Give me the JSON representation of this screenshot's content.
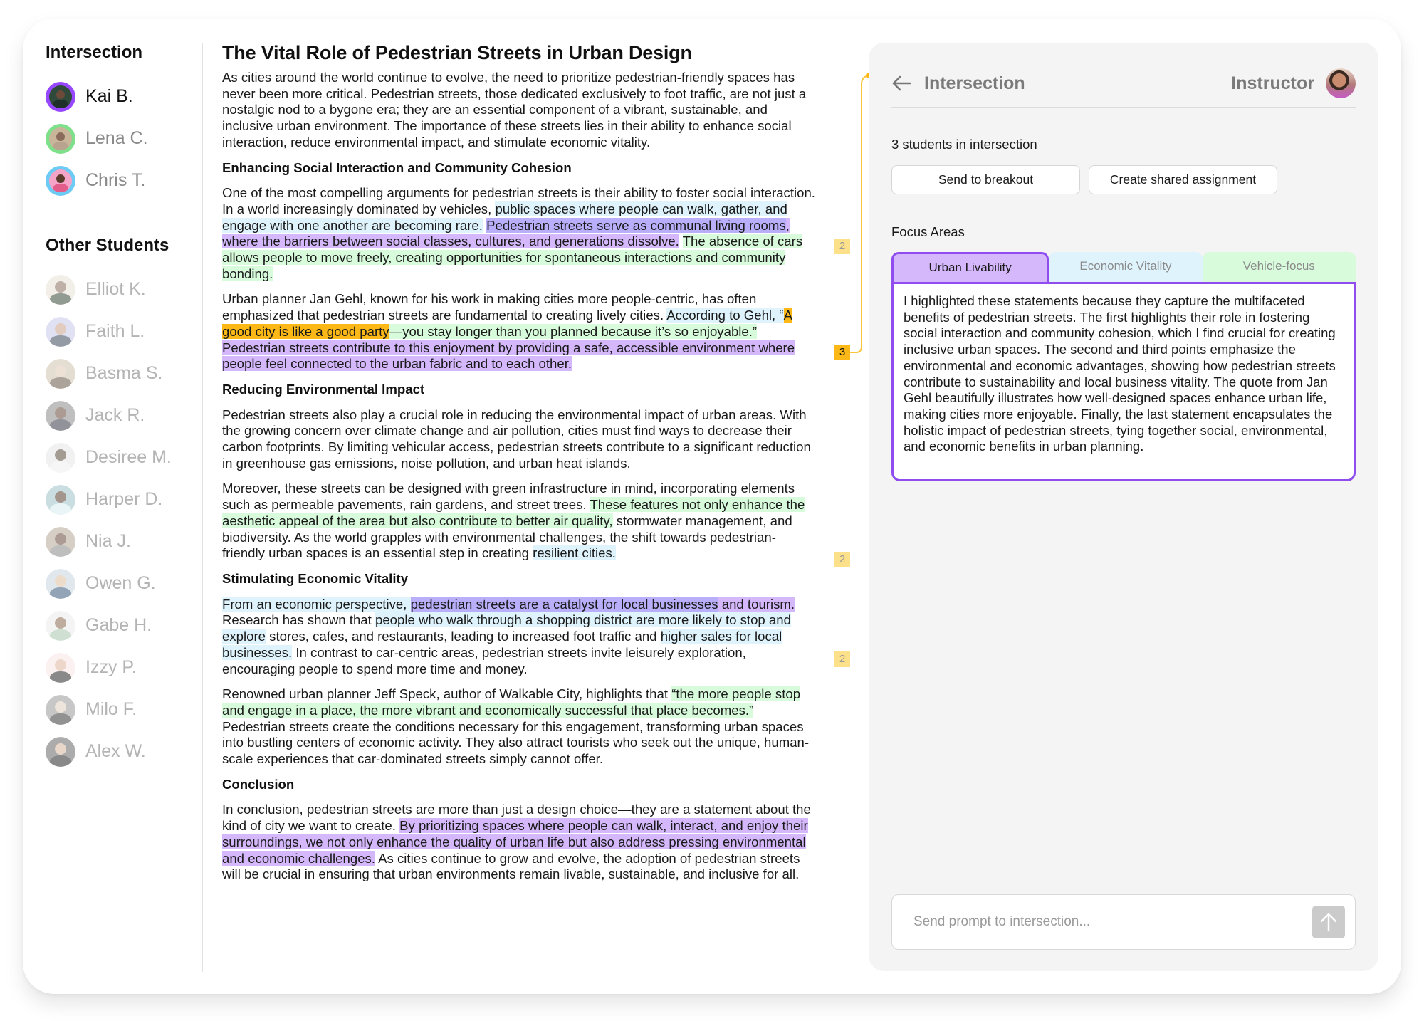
{
  "sidebar": {
    "intersection_title": "Intersection",
    "intersection_students": [
      {
        "name": "Kai B.",
        "ring": "#9747ff",
        "active": true
      },
      {
        "name": "Lena C.",
        "ring": "#7ee08a",
        "active": false
      },
      {
        "name": "Chris T.",
        "ring": "#6ccbf5",
        "active": false
      }
    ],
    "other_title": "Other Students",
    "other_students": [
      {
        "name": "Elliot K."
      },
      {
        "name": "Faith L."
      },
      {
        "name": "Basma S."
      },
      {
        "name": "Jack R."
      },
      {
        "name": "Desiree M."
      },
      {
        "name": "Harper D."
      },
      {
        "name": "Nia J."
      },
      {
        "name": "Owen G."
      },
      {
        "name": "Gabe H."
      },
      {
        "name": "Izzy P."
      },
      {
        "name": "Milo F."
      },
      {
        "name": "Alex W."
      }
    ]
  },
  "article": {
    "title": "The Vital Role of Pedestrian Streets in Urban Design",
    "intro": "As cities around the world continue to evolve, the need to prioritize pedestrian-friendly spaces has never been more critical. Pedestrian streets, those dedicated exclusively to foot traffic, are not just a nostalgic nod to a bygone era; they are an essential component of a vibrant, sustainable, and inclusive urban environment. The importance of these streets lies in their ability to enhance social interaction, reduce environmental impact, and stimulate economic vitality.",
    "sections": [
      {
        "heading": "Enhancing Social Interaction and Community Cohesion",
        "paragraphs": [
          [
            {
              "text": "One of the most compelling arguments for pedestrian streets is their ability to foster social interaction. In a world increasingly dominated by vehicles, "
            },
            {
              "text": "public spaces where people can walk, gather, and engage with one another are becoming rare.",
              "hl": "blue"
            },
            {
              "text": " "
            },
            {
              "text": "Pedestrian streets serve as communal living rooms",
              "hl": "mix"
            },
            {
              "text": ", where the barriers between social classes, cultures, and generations dissolve.",
              "hl": "purple"
            },
            {
              "text": " "
            },
            {
              "text": "The absence of cars allows people to move freely, creating opportunities for spontaneous interactions and community bonding.",
              "hl": "green"
            }
          ],
          [
            {
              "text": "Urban planner Jan Gehl, known for his work in making cities more people-centric, has often emphasized that pedestrian streets are fundamental to creating lively cities. "
            },
            {
              "text": "According to Gehl, “",
              "hl": "blue"
            },
            {
              "text": "A good city is like a good party",
              "hl": "orange"
            },
            {
              "text": "—you stay longer than you planned because it’s so enjoyable.”",
              "hl": "green"
            },
            {
              "text": " "
            },
            {
              "text": "Pedestrian streets contribute to this enjoyment by providing a safe, accessible environment where people feel connected to the urban fabric and to each other.",
              "hl": "purple"
            }
          ]
        ]
      },
      {
        "heading": "Reducing Environmental Impact",
        "paragraphs": [
          [
            {
              "text": "Pedestrian streets also play a crucial role in reducing the environmental impact of urban areas. With the growing concern over climate change and air pollution, cities must find ways to decrease their carbon footprints. By limiting vehicular access, pedestrian streets contribute to a significant reduction in greenhouse gas emissions, noise pollution, and urban heat islands."
            }
          ],
          [
            {
              "text": "Moreover, these streets can be designed with green infrastructure in mind, incorporating elements such as permeable pavements, rain gardens, and street trees. "
            },
            {
              "text": "These features not only enhance the aesthetic appeal of the area but also contribute to better air quality,",
              "hl": "green"
            },
            {
              "text": " stormwater management, and biodiversity. As the world grapples with environmental challenges, the shift towards pedestrian-friendly urban spaces is an essential step in creating "
            },
            {
              "text": "resilient cities.",
              "hl": "blue"
            }
          ]
        ]
      },
      {
        "heading": "Stimulating Economic Vitality",
        "paragraphs": [
          [
            {
              "text": "From an economic perspective, ",
              "hl": "blue"
            },
            {
              "text": "pedestrian streets are a catalyst for local businesses",
              "hl": "mix"
            },
            {
              "text": " and tourism.",
              "hl": "purple"
            },
            {
              "text": " Research has shown that "
            },
            {
              "text": "people who walk through a shopping district are more likely to stop and explore",
              "hl": "blue"
            },
            {
              "text": " stores, cafes, and restaurants, leading to increased foot traffic and "
            },
            {
              "text": "higher sales for local businesses.",
              "hl": "blue"
            },
            {
              "text": " In contrast to car-centric areas, pedestrian streets invite leisurely exploration, encouraging people to spend more time and money."
            }
          ],
          [
            {
              "text": "Renowned urban planner Jeff Speck, author of Walkable City, highlights that "
            },
            {
              "text": "“the more people stop and engage in a place, the more vibrant and economically successful that place becomes.”",
              "hl": "green"
            },
            {
              "text": " Pedestrian streets create the conditions necessary for this engagement, transforming urban spaces into bustling centers of economic activity. They also attract tourists who seek out the unique, human-scale experiences that car-dominated streets simply cannot offer."
            }
          ]
        ]
      },
      {
        "heading": "Conclusion",
        "paragraphs": [
          [
            {
              "text": "In conclusion, pedestrian streets are more than just a design choice—they are a statement about the kind of city we want to create. "
            },
            {
              "text": "By prioritizing spaces where people can walk, interact, and enjoy their surroundings, we not only enhance the quality of urban life but also address pressing environmental and economic challenges.",
              "hl": "purple"
            },
            {
              "text": " As cities continue to grow and evolve, the adoption of pedestrian streets will be crucial in ensuring that urban environments remain livable, sustainable, and inclusive for all."
            }
          ]
        ]
      }
    ],
    "markers": [
      {
        "count": "2",
        "active": false
      },
      {
        "count": "3",
        "active": true
      },
      {
        "count": "2",
        "active": false
      },
      {
        "count": "2",
        "active": false
      }
    ]
  },
  "highlight_colors": {
    "blue": "#dff3fc",
    "purple": "#d5b8fc",
    "mix": "#b9aefa",
    "green": "#d8fbdc",
    "orange": "#fbb817"
  },
  "panel": {
    "title": "Intersection",
    "back_icon": "arrow-left-icon",
    "instructor_label": "Instructor",
    "student_count": "3 students in intersection",
    "buttons": {
      "breakout": "Send to breakout",
      "shared_assignment": "Create shared assignment"
    },
    "focus_label": "Focus Areas",
    "tabs": [
      {
        "label": "Urban Livability",
        "selected": true
      },
      {
        "label": "Economic Vitality",
        "selected": false
      },
      {
        "label": "Vehicle-focus",
        "selected": false
      }
    ],
    "tab_content": "I highlighted these statements because they capture the multifaceted benefits of pedestrian streets. The first highlights their role in fostering social interaction and community cohesion, which I find crucial for creating inclusive urban spaces. The second and third points emphasize the environmental and economic advantages, showing how pedestrian streets contribute to sustainability and local business vitality. The quote from Jan Gehl beautifully illustrates how well-designed spaces enhance urban life, making cities more enjoyable. Finally, the last statement encapsulates the holistic impact of pedestrian streets, tying together social, environmental, and economic benefits in urban planning.",
    "prompt": {
      "placeholder": "Send prompt to intersection...",
      "value": "",
      "send_icon": "arrow-up-icon"
    }
  }
}
